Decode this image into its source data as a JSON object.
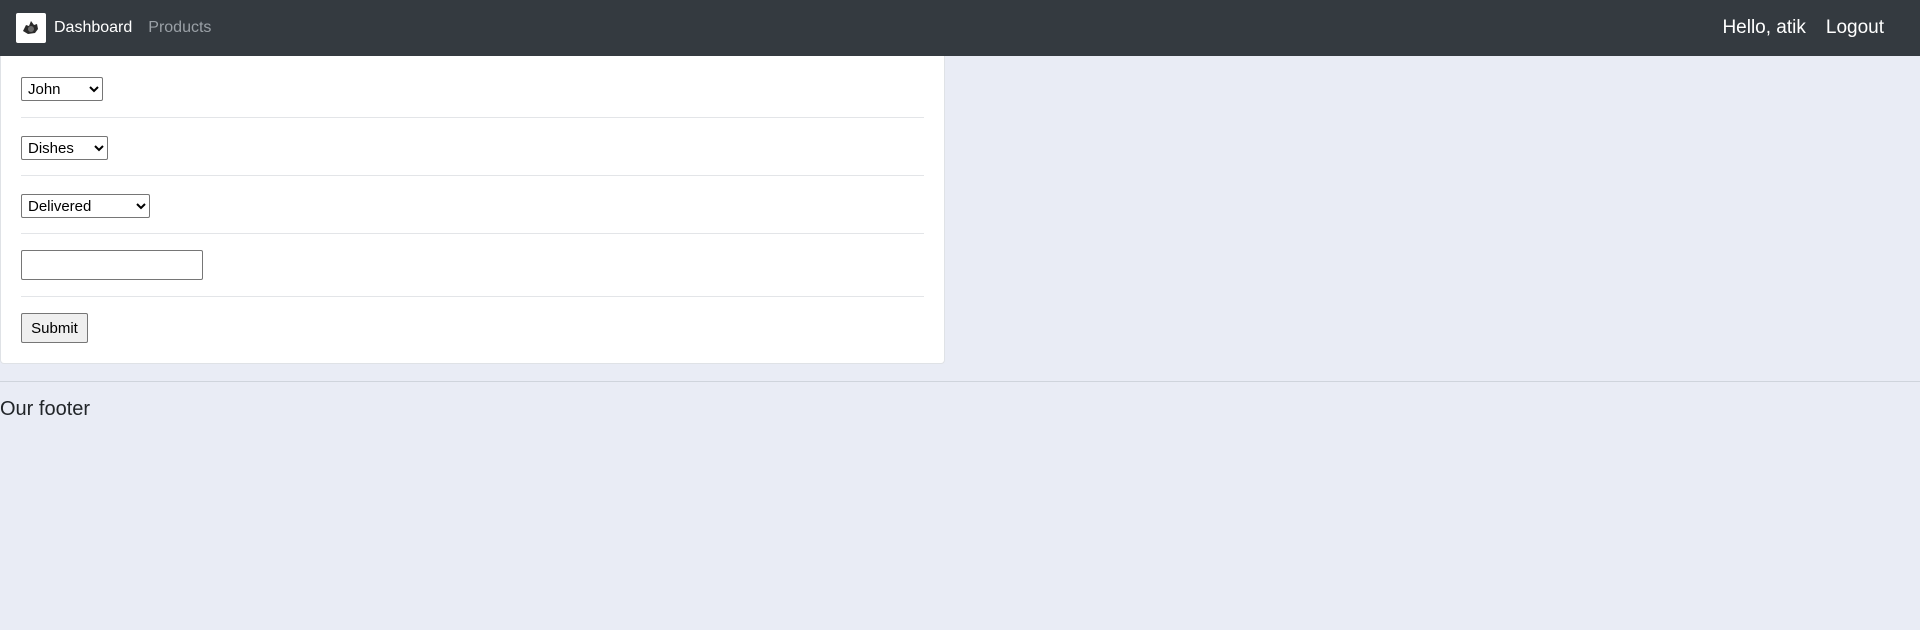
{
  "navbar": {
    "brand_label": "Dashboard",
    "brand_icon": "logo-icon",
    "products_label": "Products",
    "greeting": "Hello, atik",
    "logout_label": "Logout"
  },
  "form": {
    "customer_select": {
      "selected": "John"
    },
    "product_select": {
      "selected": "Dishes"
    },
    "status_select": {
      "selected": "Delivered"
    },
    "text_input": {
      "value": ""
    },
    "submit_label": "Submit"
  },
  "footer": {
    "text": "Our footer"
  },
  "colors": {
    "navbar_bg": "#343a40",
    "page_bg": "#e9ecf5",
    "card_bg": "#ffffff"
  }
}
